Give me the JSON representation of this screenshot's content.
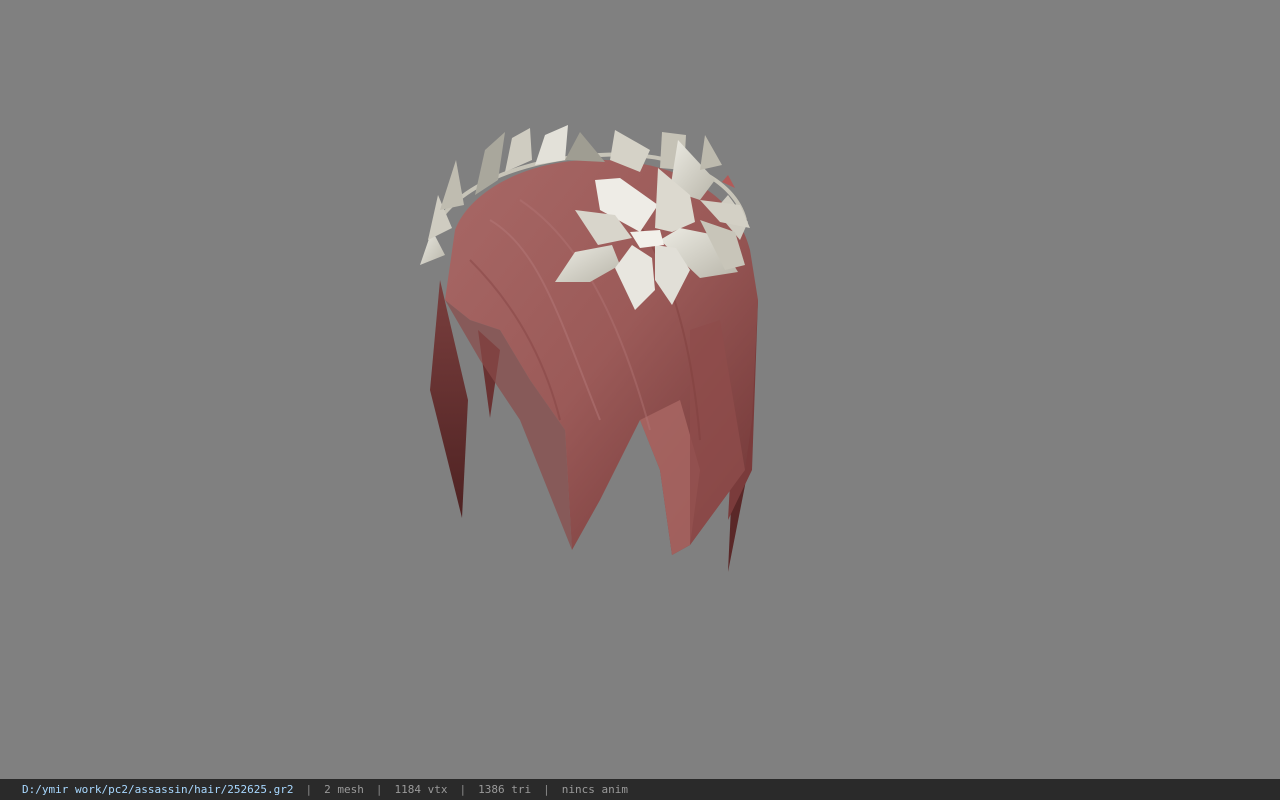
{
  "viewport": {
    "background": "#808080",
    "model": {
      "icon": "hair-with-laurel-wreath-3d-model",
      "hair_color": "#9b5a58",
      "leaf_color": "#d9d6cc"
    }
  },
  "statusbar": {
    "file_path": "D:/ymir work/pc2/assassin/hair/252625.gr2",
    "separator": "|",
    "mesh_count": "2 mesh",
    "vertex_count": "1184 vtx",
    "triangle_count": "1386 tri",
    "anim_status": "nincs anim"
  }
}
